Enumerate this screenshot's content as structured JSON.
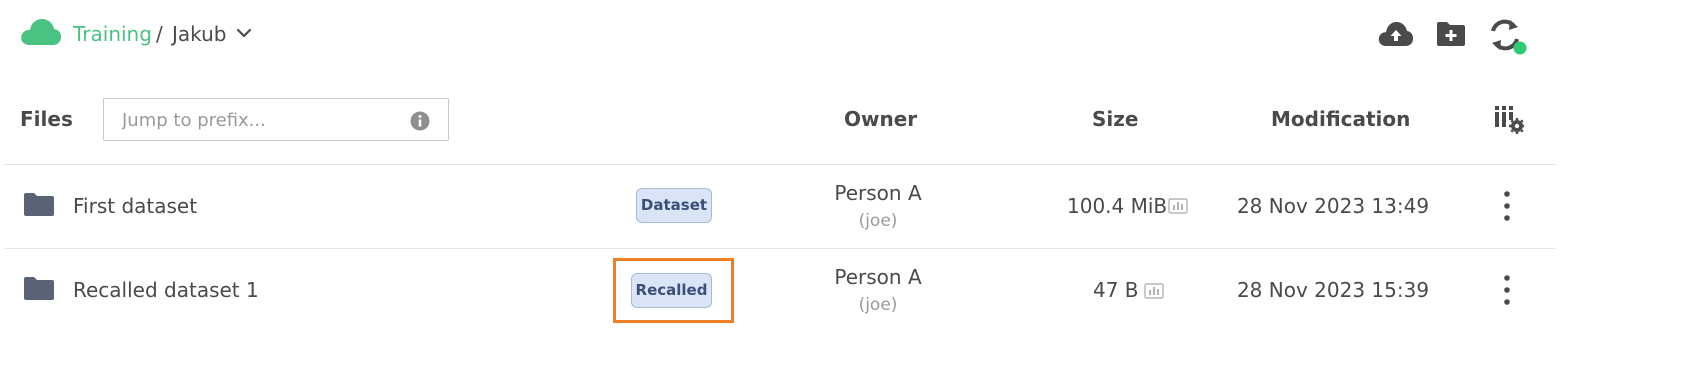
{
  "breadcrumb": {
    "space": "Training",
    "separator": "/",
    "directory": "Jakub"
  },
  "toolbar": {
    "icons": [
      "cloud-upload-icon",
      "new-folder-icon",
      "sync-icon"
    ],
    "sync_status_color": "#2ecc71"
  },
  "table": {
    "header": {
      "files_label": "Files",
      "prefix_placeholder": "Jump to prefix...",
      "owner_label": "Owner",
      "size_label": "Size",
      "modification_label": "Modification"
    },
    "rows": [
      {
        "name": "First dataset",
        "tag": "Dataset",
        "owner_name": "Person A",
        "owner_login": "(joe)",
        "size": "100.4 MiB",
        "modified": "28 Nov 2023 13:49"
      },
      {
        "name": "Recalled dataset 1",
        "tag": "Recalled",
        "owner_name": "Person A",
        "owner_login": "(joe)",
        "size": "47 B",
        "modified": "28 Nov 2023 15:39"
      }
    ]
  },
  "colors": {
    "brand_green": "#4ac282",
    "highlight_orange": "#f07d28",
    "tag_bg": "#d9e4f6",
    "folder": "#5a6275"
  }
}
